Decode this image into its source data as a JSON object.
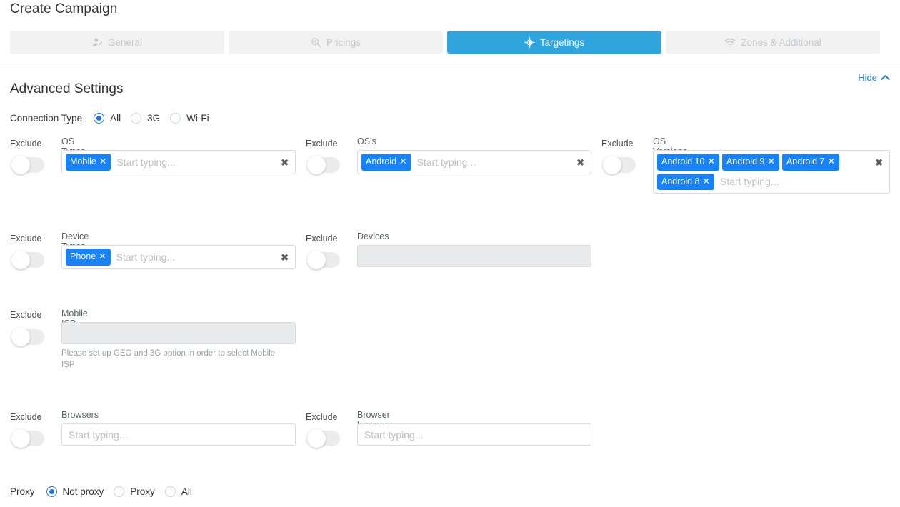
{
  "header": {
    "title": "Create Campaign"
  },
  "tabs": [
    {
      "label": "General",
      "icon": "user-edit-icon",
      "active": false
    },
    {
      "label": "Pricings",
      "icon": "search-dollar-icon",
      "active": false
    },
    {
      "label": "Targetings",
      "icon": "crosshair-icon",
      "active": true
    },
    {
      "label": "Zones & Additional",
      "icon": "wifi-icon",
      "active": false
    }
  ],
  "section": {
    "title": "Advanced Settings",
    "hide_label": "Hide",
    "hide_icon": "chevron-up-icon"
  },
  "connection_type": {
    "label": "Connection Type",
    "options": [
      {
        "label": "All",
        "selected": true
      },
      {
        "label": "3G",
        "selected": false
      },
      {
        "label": "Wi-Fi",
        "selected": false
      }
    ]
  },
  "exclude_label": "Exclude",
  "placeholder": "Start typing...",
  "clear_icon": "close-icon",
  "fields": {
    "os_types": {
      "label": "OS Types",
      "placeholder": "Start typing...",
      "chips": [
        "Mobile"
      ],
      "disabled": false,
      "has_clear": true,
      "exclude_on": false
    },
    "oss": {
      "label": "OS's",
      "placeholder": "Start typing...",
      "chips": [
        "Android"
      ],
      "disabled": false,
      "has_clear": true,
      "exclude_on": false
    },
    "os_versions": {
      "label": "OS Versions",
      "placeholder": "Start typing...",
      "chips": [
        "Android 10",
        "Android 9",
        "Android 7",
        "Android 8"
      ],
      "disabled": false,
      "has_clear": true,
      "exclude_on": false
    },
    "device_types": {
      "label": "Device Types",
      "placeholder": "Start typing...",
      "chips": [
        "Phone"
      ],
      "disabled": false,
      "has_clear": true,
      "exclude_on": false
    },
    "devices": {
      "label": "Devices",
      "placeholder": "",
      "chips": [],
      "disabled": true,
      "has_clear": false,
      "exclude_on": false
    },
    "mobile_isp": {
      "label": "Mobile ISP",
      "placeholder": "",
      "chips": [],
      "disabled": true,
      "has_clear": false,
      "exclude_on": false,
      "help": "Please set up GEO and 3G option in order to select Mobile ISP"
    },
    "browsers": {
      "label": "Browsers",
      "placeholder": "Start typing...",
      "chips": [],
      "disabled": false,
      "has_clear": false,
      "exclude_on": false
    },
    "browser_language": {
      "label": "Browser language",
      "placeholder": "Start typing...",
      "chips": [],
      "disabled": false,
      "has_clear": false,
      "exclude_on": false
    }
  },
  "proxy": {
    "label": "Proxy",
    "options": [
      {
        "label": "Not proxy",
        "selected": true
      },
      {
        "label": "Proxy",
        "selected": false
      },
      {
        "label": "All",
        "selected": false
      }
    ]
  },
  "colors": {
    "accent": "#2fa4dd",
    "chip": "#1a82f7",
    "radio": "#1a73e8",
    "link": "#2f7ec4"
  }
}
